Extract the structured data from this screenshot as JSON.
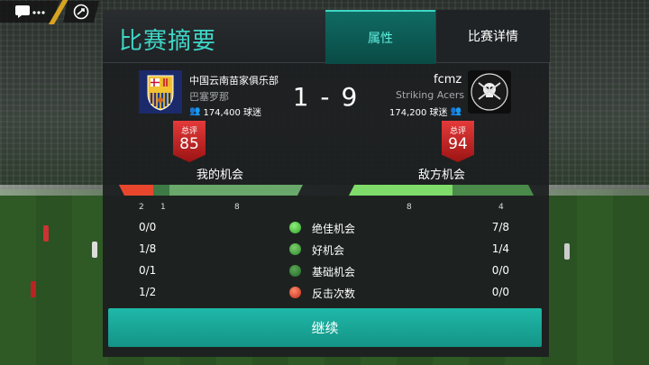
{
  "hud": {
    "chat_icon": "chat-icon",
    "share_icon": "share-icon"
  },
  "panel": {
    "title": "比赛摘要",
    "tabs": [
      {
        "label": "属性",
        "active": true
      },
      {
        "label": "比赛详情",
        "active": false
      }
    ]
  },
  "home": {
    "name": "中国云南苗家俱乐部",
    "club": "巴塞罗那",
    "fans": "174,400 球迷",
    "rating_label": "总评",
    "rating": "85",
    "chances_label": "我的机会",
    "crest_icon": "fc-barcelona-crest-icon"
  },
  "away": {
    "name": "fcmz",
    "club": "Striking Acers",
    "fans": "174,200 球迷",
    "rating_label": "总评",
    "rating": "94",
    "chances_label": "敌方机会",
    "crest_icon": "skull-crest-icon"
  },
  "score": "1 - 9",
  "bar_ticks": {
    "home": [
      "2",
      "1",
      "8"
    ],
    "away": [
      "8",
      "4"
    ]
  },
  "stats": [
    {
      "home": "0/0",
      "label": "绝佳机会",
      "away": "7/8",
      "ball_color": "#3fbf3a"
    },
    {
      "home": "1/8",
      "label": "好机会",
      "away": "1/4",
      "ball_color": "#3a9a3a"
    },
    {
      "home": "0/1",
      "label": "基础机会",
      "away": "0/0",
      "ball_color": "#2e7a30"
    },
    {
      "home": "1/2",
      "label": "反击次数",
      "away": "0/0",
      "ball_color": "#e0412a"
    }
  ],
  "continue_label": "继续",
  "colors": {
    "accent": "#3fd6c6",
    "rating_red": "#d42a2a",
    "button": "#1aa898"
  }
}
